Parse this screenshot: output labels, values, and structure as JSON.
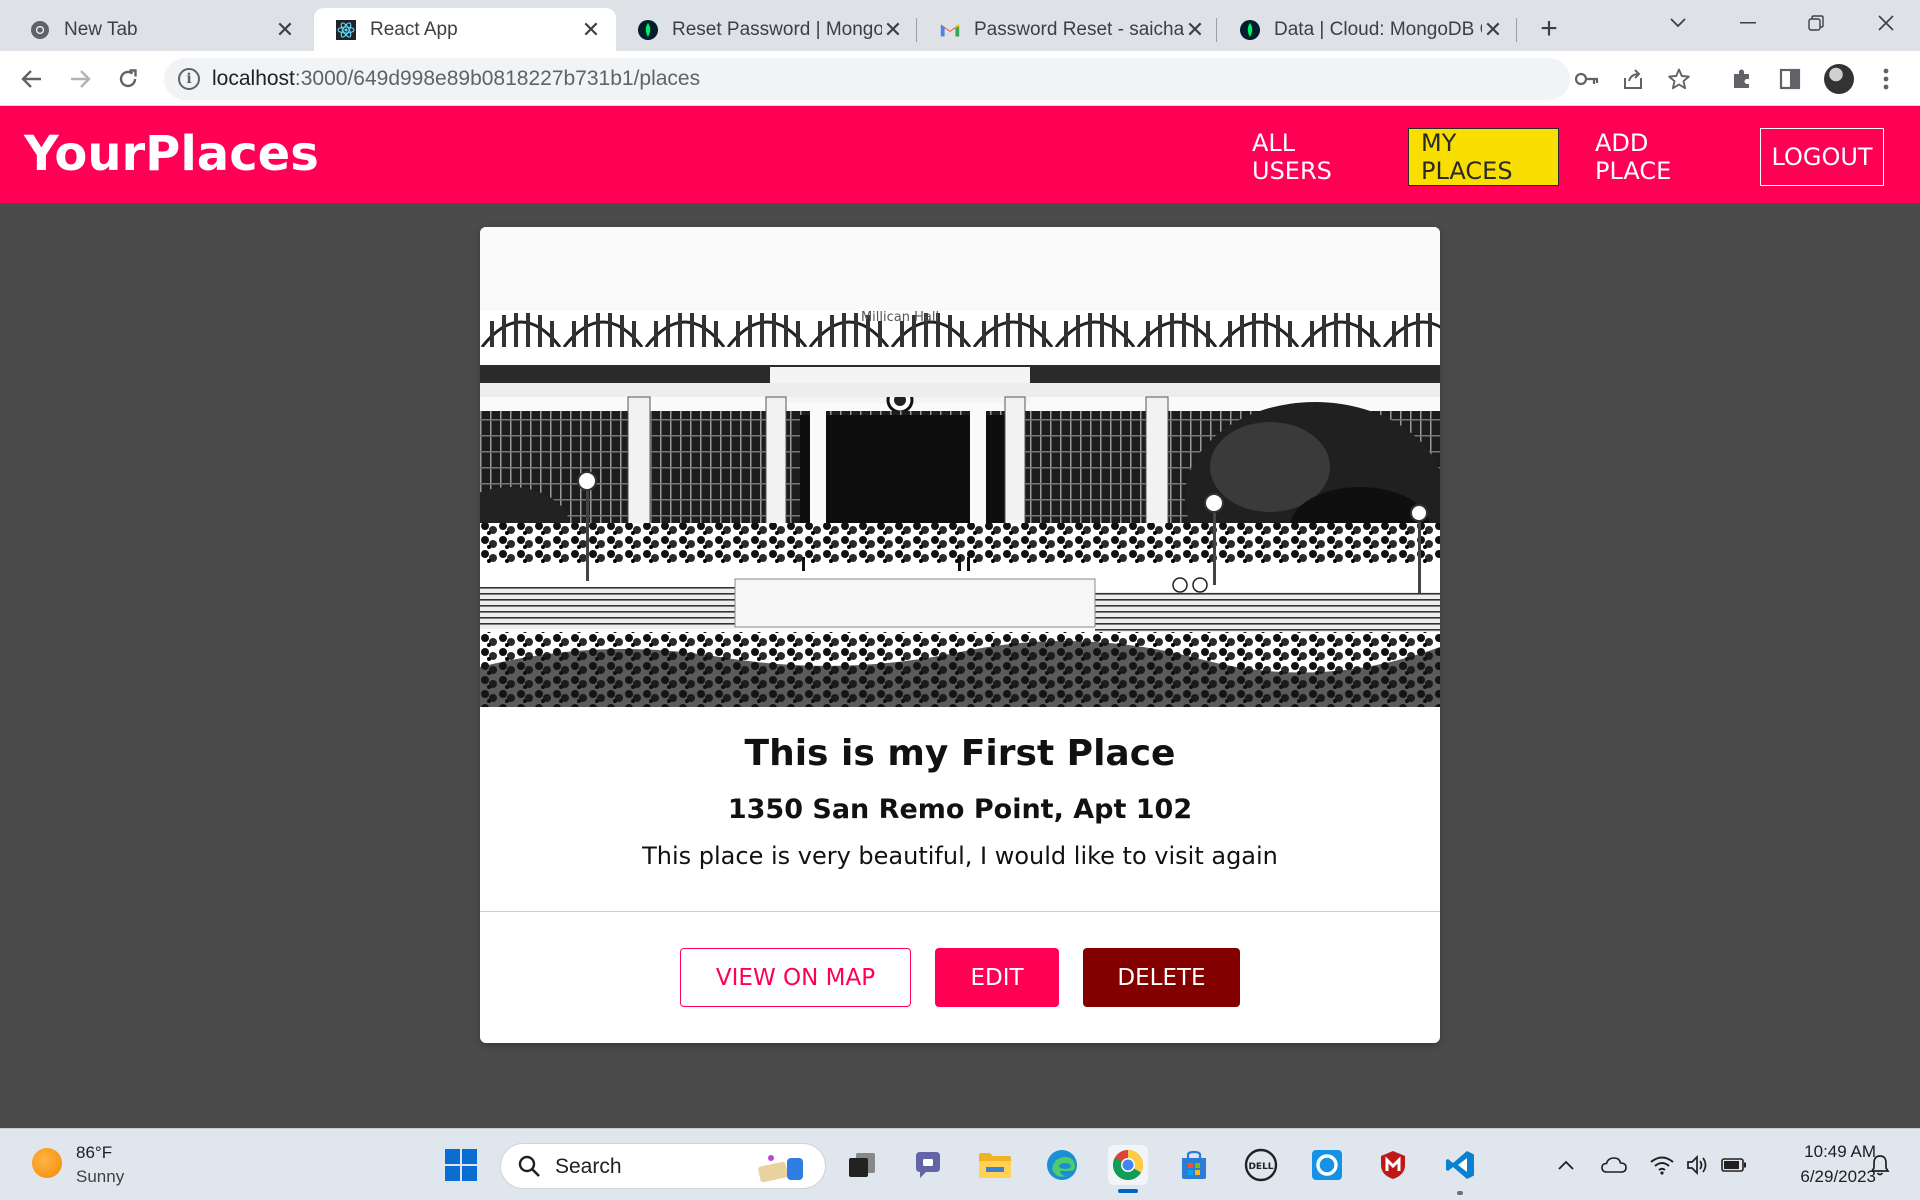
{
  "browser": {
    "tabs": [
      {
        "title": "New Tab",
        "icon": "chrome-icon",
        "active": false
      },
      {
        "title": "React App",
        "icon": "react-icon",
        "active": true
      },
      {
        "title": "Reset Password | MongoDB",
        "icon": "mongodb-leaf-icon",
        "active": false
      },
      {
        "title": "Password Reset - saicharan",
        "icon": "gmail-icon",
        "active": false
      },
      {
        "title": "Data | Cloud: MongoDB Cloud",
        "icon": "mongodb-leaf-icon",
        "active": false
      }
    ],
    "close_glyph": "✕",
    "new_tab_glyph": "+",
    "url_host": "localhost",
    "url_path": ":3000/649d998e89b0818227b731b1/places"
  },
  "app": {
    "brand": "YourPlaces",
    "nav": {
      "all_users": "ALL USERS",
      "my_places": "MY PLACES",
      "add_place": "ADD PLACE",
      "logout": "LOGOUT"
    },
    "colors": {
      "header": "#ff0055",
      "active_nav": "#f8df00",
      "danger": "#830000",
      "background": "#4b4b4b"
    }
  },
  "place": {
    "image_caption": "Millican Hall",
    "title": "This is my First Place",
    "address": "1350 San Remo Point, Apt 102",
    "description": "This place is very beautiful, I would like to visit again",
    "buttons": {
      "view_on_map": "VIEW ON MAP",
      "edit": "EDIT",
      "delete": "DELETE"
    }
  },
  "taskbar": {
    "weather_temp": "86°F",
    "weather_condition": "Sunny",
    "search_label": "Search",
    "time": "10:49 AM",
    "date": "6/29/2023",
    "pinned_apps": [
      "start-icon",
      "search-icon",
      "task-view-icon",
      "teams-chat-icon",
      "file-explorer-icon",
      "edge-icon",
      "chrome-icon",
      "microsoft-store-icon",
      "dell-icon",
      "cortana-icon",
      "mcafee-icon",
      "vscode-icon"
    ]
  }
}
